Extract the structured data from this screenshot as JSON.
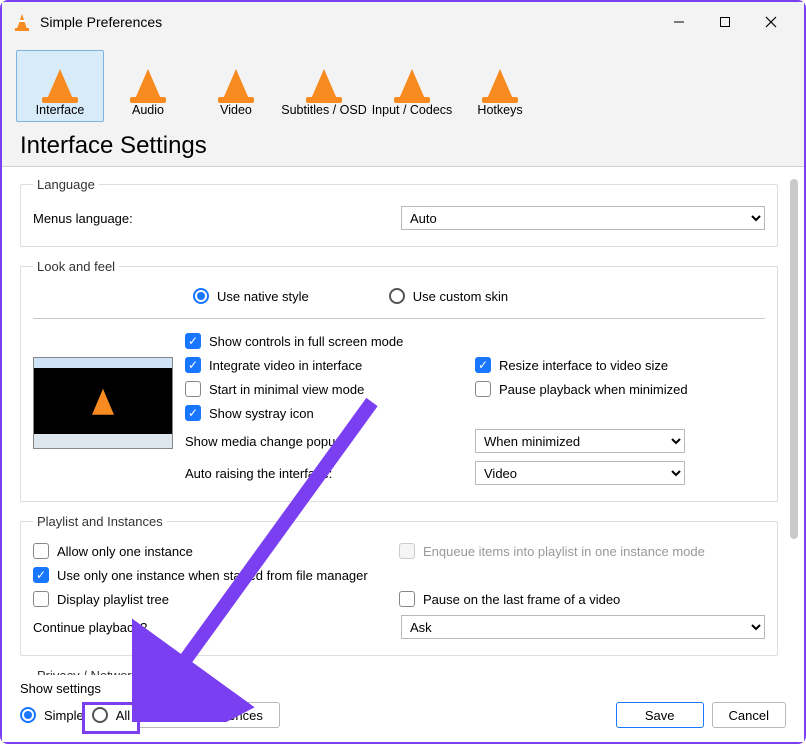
{
  "window": {
    "title": "Simple Preferences"
  },
  "categories": [
    {
      "label": "Interface",
      "selected": true
    },
    {
      "label": "Audio"
    },
    {
      "label": "Video"
    },
    {
      "label": "Subtitles / OSD"
    },
    {
      "label": "Input / Codecs"
    },
    {
      "label": "Hotkeys"
    }
  ],
  "page_title": "Interface Settings",
  "sections": {
    "language": {
      "legend": "Language",
      "menus_language_label": "Menus language:",
      "menus_language_value": "Auto"
    },
    "look_and_feel": {
      "legend": "Look and feel",
      "style_native": "Use native style",
      "style_custom": "Use custom skin",
      "show_controls_fullscreen": "Show controls in full screen mode",
      "integrate_video": "Integrate video in interface",
      "resize_to_video": "Resize interface to video size",
      "start_minimal": "Start in minimal view mode",
      "pause_minimized": "Pause playback when minimized",
      "show_systray": "Show systray icon",
      "media_change_popup_label": "Show media change popup:",
      "media_change_popup_value": "When minimized",
      "auto_raise_label": "Auto raising the interface:",
      "auto_raise_value": "Video"
    },
    "playlist": {
      "legend": "Playlist and Instances",
      "allow_one_instance": "Allow only one instance",
      "enqueue_one_instance": "Enqueue items into playlist in one instance mode",
      "use_one_from_fm": "Use only one instance when started from file manager",
      "display_tree": "Display playlist tree",
      "pause_last_frame": "Pause on the last frame of a video",
      "continue_playback_label": "Continue playback?",
      "continue_playback_value": "Ask"
    },
    "privacy": {
      "legend": "Privacy / Network Interaction"
    }
  },
  "footer": {
    "show_settings_label": "Show settings",
    "simple": "Simple",
    "all": "All",
    "reset": "Reset Preferences",
    "save": "Save",
    "cancel": "Cancel"
  }
}
